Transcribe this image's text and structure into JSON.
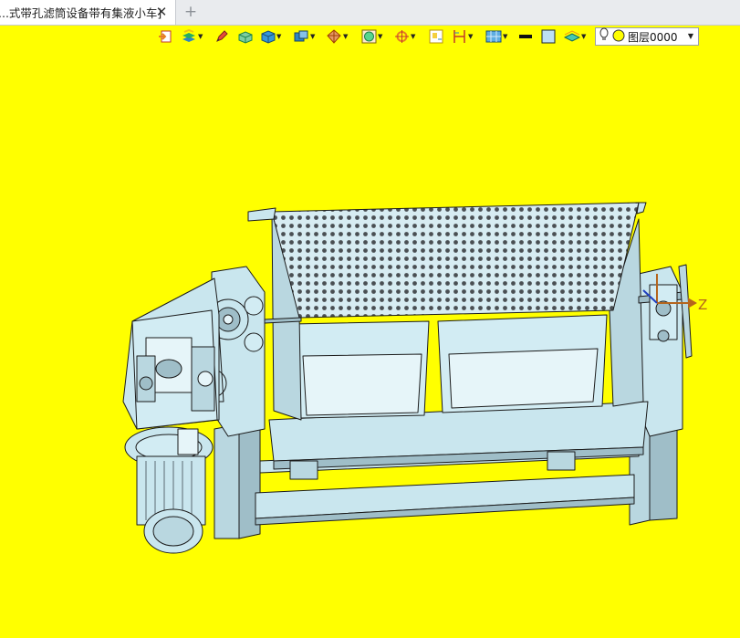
{
  "tab": {
    "title": "...式带孔滤筒设备带有集液小车]",
    "close_glyph": "✕",
    "new_glyph": "+"
  },
  "toolbar": {
    "items": [
      {
        "icon": "import-icon"
      },
      {
        "icon": "layers-stack-icon",
        "dropdown": true
      },
      {
        "icon": "pencil-icon"
      },
      {
        "icon": "box-shaded-icon"
      },
      {
        "icon": "cube-blue-icon",
        "dropdown": true
      },
      {
        "icon": "views-icon",
        "dropdown": true
      },
      {
        "icon": "section-icon",
        "dropdown": true
      },
      {
        "icon": "render-icon",
        "dropdown": true
      },
      {
        "icon": "snap-icon",
        "dropdown": true
      },
      {
        "icon": "fit-icon"
      },
      {
        "icon": "dimension-icon",
        "dropdown": true
      },
      {
        "icon": "display-mode-icon",
        "dropdown": true
      },
      {
        "icon": "line-color-icon"
      },
      {
        "icon": "fill-color-icon"
      },
      {
        "icon": "layer-manager-icon",
        "dropdown": true
      }
    ],
    "layer_select": {
      "value": "图层0000",
      "arrow": "▼"
    }
  },
  "viewport": {
    "background": "#ffff00",
    "axis_label": "Z"
  },
  "colors": {
    "part": "#c9e6ee",
    "part_dark": "#9fb9c2",
    "outline": "#1b1b1b"
  }
}
